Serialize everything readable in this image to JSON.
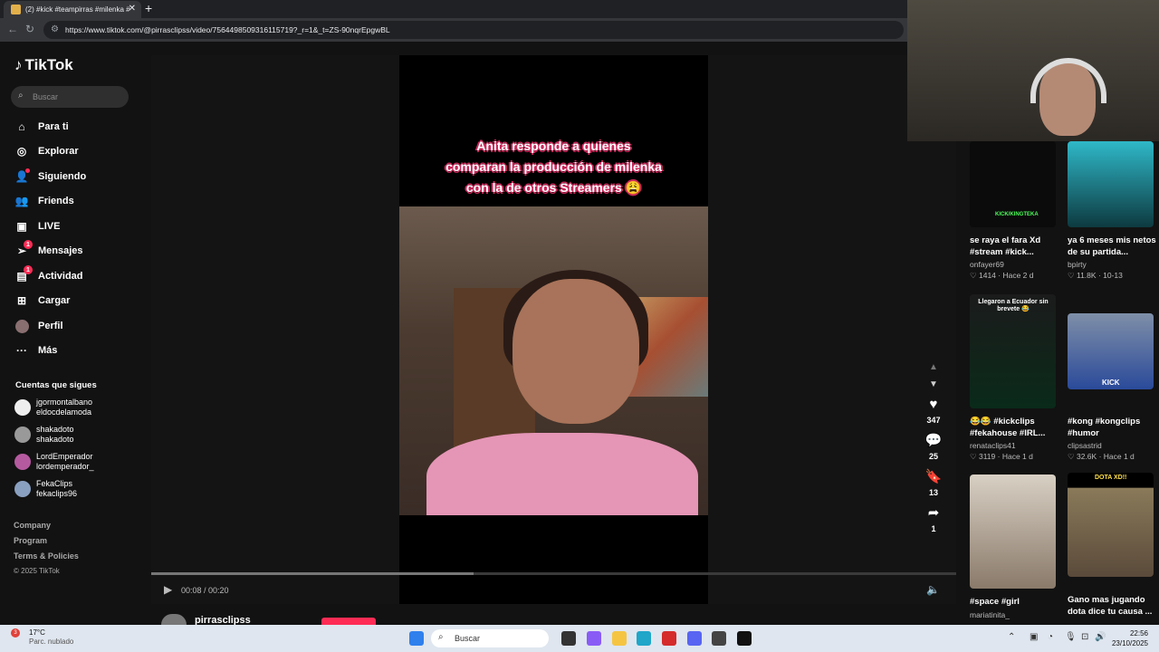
{
  "browser": {
    "tab_title": "(2) #kick #teampirras #milenka #",
    "url": "https://www.tiktok.com/@pirrasclipss/video/7564498509316115719?_r=1&_t=ZS-90nqrEpgwBL"
  },
  "sidebar": {
    "logo": "TikTok",
    "search_placeholder": "Buscar",
    "menu": [
      {
        "label": "Para ti"
      },
      {
        "label": "Explorar"
      },
      {
        "label": "Siguiendo"
      },
      {
        "label": "Friends"
      },
      {
        "label": "LIVE"
      },
      {
        "label": "Mensajes",
        "badge": "1"
      },
      {
        "label": "Actividad",
        "badge": "1"
      },
      {
        "label": "Cargar"
      },
      {
        "label": "Perfil"
      },
      {
        "label": "Más"
      }
    ],
    "following_title": "Cuentas que sigues",
    "following": [
      {
        "name": "jgormontalbano",
        "handle": "eldocdelamoda"
      },
      {
        "name": "shakadoto",
        "handle": "shakadoto"
      },
      {
        "name": "LordEmperador",
        "handle": "lordemperador_"
      },
      {
        "name": "FekaClips",
        "handle": "fekaclips96"
      }
    ],
    "footer": [
      "Company",
      "Program",
      "Terms & Policies",
      "© 2025 TikTok"
    ]
  },
  "video": {
    "caption_lines": [
      "Anita responde a quienes",
      "comparan la producción de milenka",
      "con la de otros Streamers 😩"
    ],
    "time": "00:08 / 00:20",
    "progress": 0.4
  },
  "actions": {
    "likes": "347",
    "comments": "25",
    "saves": "13",
    "shares": "1"
  },
  "author": {
    "name": "pirrasclipss"
  },
  "recommended": [
    {
      "title": "se raya el fara Xd #stream #kick...",
      "author": "onfayer69",
      "likes": "1414",
      "date": "Hace 2 d",
      "thumb_text": "KICK/KINGTEKA"
    },
    {
      "title": "ya 6 meses mis netos de su partida...",
      "author": "bpirty",
      "likes": "11.8K",
      "date": "10-13",
      "thumb_text": ""
    },
    {
      "title": "😂😂 #kickclips #fekahouse #IRL...",
      "author": "renataclips41",
      "likes": "3119",
      "date": "Hace 1 d",
      "thumb_text": "Llegaron a Ecuador sin brevete 😂"
    },
    {
      "title": "#kong #kongclips #humor",
      "author": "clipsastrid",
      "likes": "32.6K",
      "date": "Hace 1 d",
      "thumb_text": "KICK"
    },
    {
      "title": "#space #girl",
      "author": "mariatinita_",
      "likes": "",
      "date": "",
      "thumb_text": ""
    },
    {
      "title": "Gano mas jugando dota dice tu causa ...",
      "author": "",
      "likes": "",
      "date": "",
      "thumb_text": "DOTA XD!!"
    }
  ],
  "taskbar": {
    "temp": "17°C",
    "weather": "Parc. nublado",
    "weather_badge": "3",
    "search": "Buscar",
    "time": "22:56",
    "date": "23/10/2025"
  },
  "colors": {
    "accent": "#fe2c55",
    "background": "#121212"
  }
}
